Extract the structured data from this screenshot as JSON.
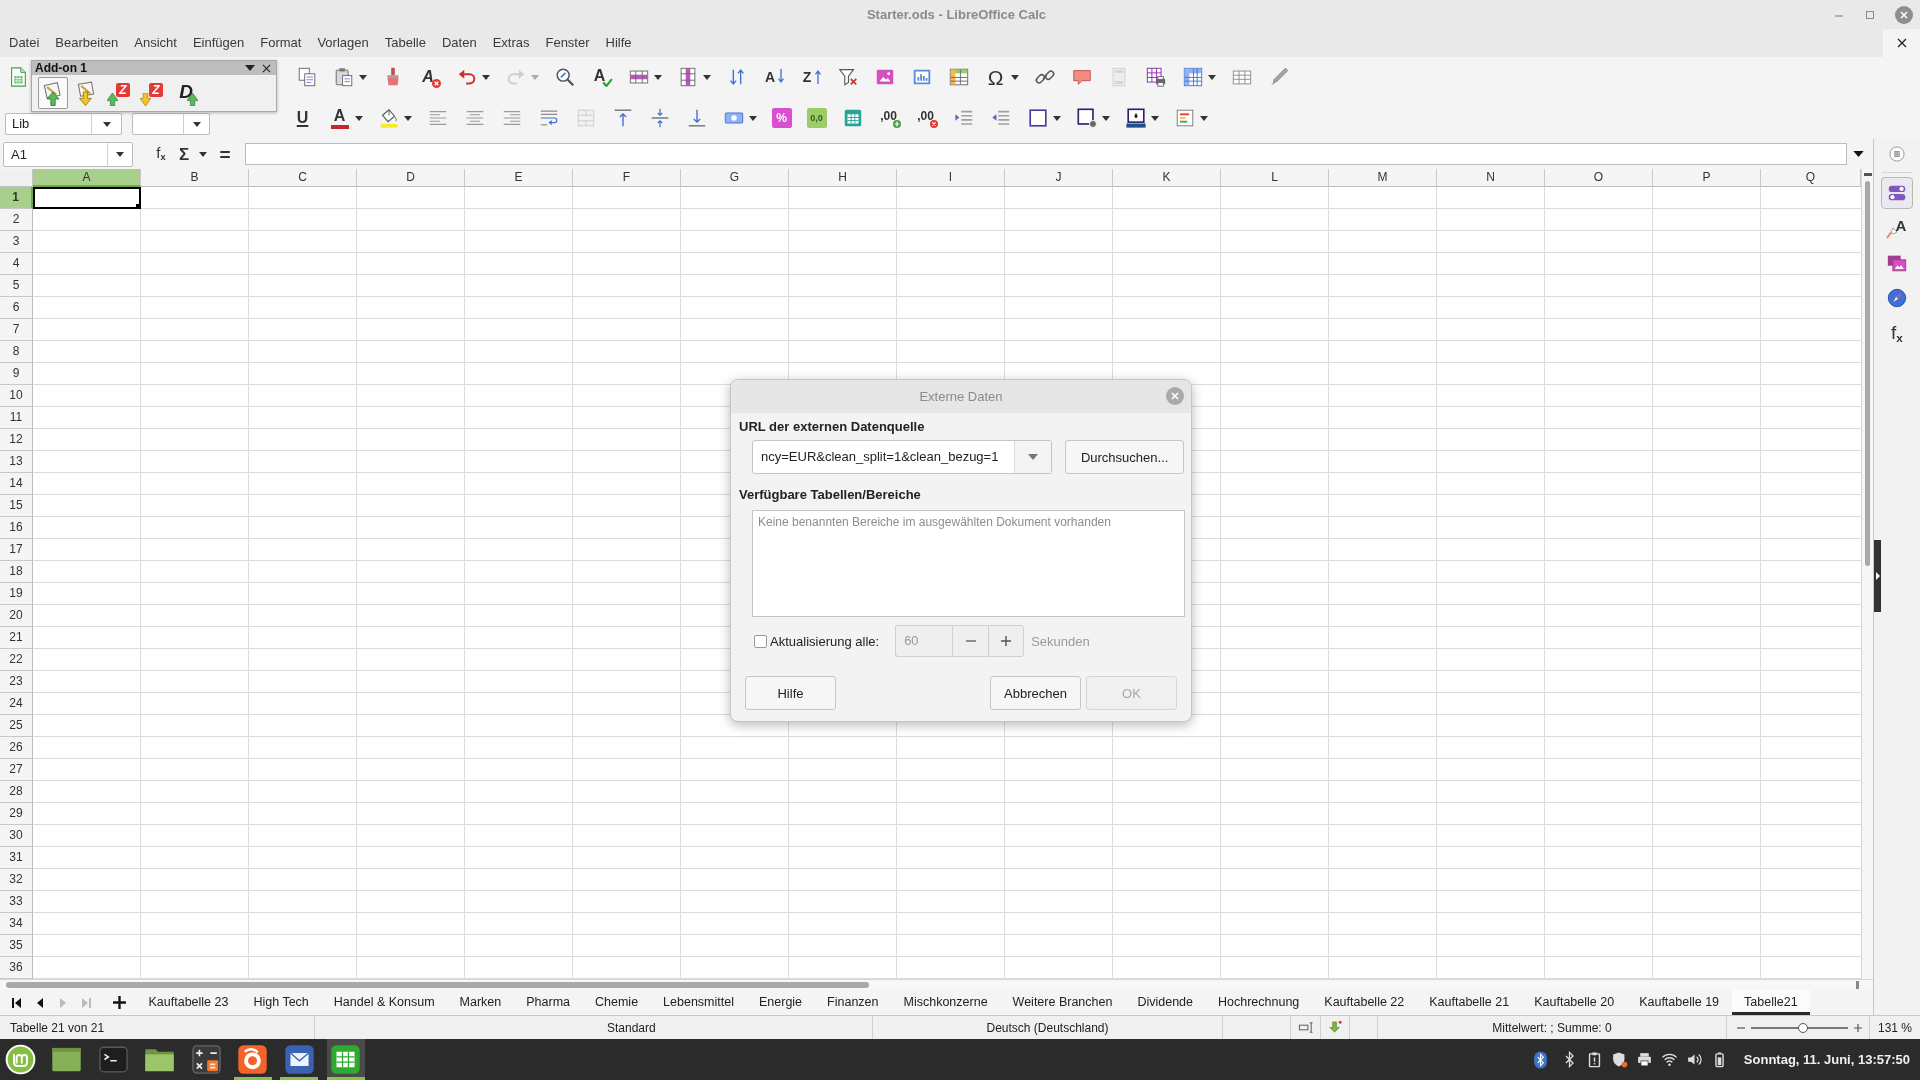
{
  "window": {
    "title": "Starter.ods - LibreOffice Calc"
  },
  "menu_bar": [
    "Datei",
    "Bearbeiten",
    "Ansicht",
    "Einfügen",
    "Format",
    "Vorlagen",
    "Tabelle",
    "Daten",
    "Extras",
    "Fenster",
    "Hilfe"
  ],
  "standard_toolbar": [
    {
      "kind": "newsheet",
      "disabled": false
    },
    {
      "kind": "copy",
      "disabled": false
    },
    {
      "kind": "paste",
      "disabled": false,
      "menu": true
    },
    {
      "kind": "clone",
      "disabled": false
    },
    {
      "kind": "clear",
      "glyph": "A",
      "disabled": false
    },
    {
      "kind": "undo",
      "disabled": false,
      "menu": true
    },
    {
      "kind": "redo",
      "disabled": true,
      "menu": true
    },
    {
      "kind": "find",
      "disabled": false
    },
    {
      "kind": "spelling",
      "glyph": "A",
      "disabled": false
    },
    {
      "kind": "rows",
      "disabled": false,
      "menu": true
    },
    {
      "kind": "columns",
      "disabled": false,
      "menu": true
    },
    {
      "kind": "sort",
      "disabled": false
    },
    {
      "kind": "sortasc",
      "glyph": "A",
      "disabled": false
    },
    {
      "kind": "sortdesc",
      "glyph": "Z",
      "disabled": false
    },
    {
      "kind": "autofilter",
      "disabled": false
    },
    {
      "kind": "image",
      "disabled": false
    },
    {
      "kind": "chart",
      "disabled": false
    },
    {
      "kind": "pivot",
      "disabled": false
    },
    {
      "kind": "special",
      "glyph": "Ω",
      "disabled": false,
      "menu": true
    },
    {
      "kind": "link",
      "disabled": false
    },
    {
      "kind": "comment",
      "disabled": false
    },
    {
      "kind": "headers",
      "disabled": true
    },
    {
      "kind": "printarea",
      "disabled": false
    },
    {
      "kind": "freeze",
      "disabled": false,
      "menu": true
    },
    {
      "kind": "split",
      "disabled": false
    },
    {
      "kind": "draw",
      "disabled": false
    }
  ],
  "addon_toolbar": {
    "title": "Add-on 1",
    "items": [
      {
        "kind": "sheetup",
        "selected": true
      },
      {
        "kind": "sheetdown",
        "selected": false
      },
      {
        "kind": "zup",
        "glyph": "Z",
        "selected": false
      },
      {
        "kind": "zdown",
        "glyph": "Z",
        "selected": false
      },
      {
        "kind": "dup",
        "glyph": "D",
        "selected": false
      }
    ]
  },
  "formatting_toolbar": {
    "font_name": {
      "value": "Lib"
    },
    "items": [
      {
        "kind": "underline",
        "glyph": "U",
        "disabled": false
      },
      {
        "kind": "fontcolor",
        "glyph": "A",
        "disabled": false,
        "menu": true
      },
      {
        "kind": "highlight",
        "disabled": false,
        "menu": true
      },
      {
        "kind": "alignleft",
        "disabled": false
      },
      {
        "kind": "aligncenter",
        "disabled": false
      },
      {
        "kind": "alignright",
        "disabled": false
      },
      {
        "kind": "wrap",
        "disabled": false
      },
      {
        "kind": "merge",
        "disabled": true
      },
      {
        "kind": "aligntop",
        "disabled": false
      },
      {
        "kind": "alignmiddle",
        "disabled": false
      },
      {
        "kind": "alignbottom",
        "disabled": false
      },
      {
        "kind": "currency",
        "disabled": false,
        "menu": true
      },
      {
        "kind": "percent",
        "glyph": "%",
        "disabled": false
      },
      {
        "kind": "number",
        "glyph": "0,0",
        "disabled": false
      },
      {
        "kind": "date",
        "disabled": false
      },
      {
        "kind": "adddecimal",
        "glyph": ",00",
        "disabled": false
      },
      {
        "kind": "deldecimal",
        "glyph": ",00",
        "disabled": false
      },
      {
        "kind": "indent",
        "disabled": false
      },
      {
        "kind": "outdent",
        "disabled": false
      },
      {
        "kind": "borders",
        "disabled": false,
        "menu": true
      },
      {
        "kind": "borderstyle",
        "disabled": false,
        "menu": true
      },
      {
        "kind": "bordercolor",
        "disabled": false,
        "menu": true
      },
      {
        "kind": "conditional",
        "disabled": false,
        "menu": true
      }
    ]
  },
  "formula_bar": {
    "name_box": "A1",
    "tools": [
      {
        "kind": "wizard",
        "glyph": "f$_{x}$"
      },
      {
        "kind": "sum",
        "glyph": "Σ",
        "menu": true
      },
      {
        "kind": "formula",
        "glyph": "="
      }
    ]
  },
  "sheet": {
    "columns": [
      {
        "label": "A",
        "selected": true
      },
      {
        "label": "B",
        "selected": false
      },
      {
        "label": "C",
        "selected": false
      },
      {
        "label": "D",
        "selected": false
      },
      {
        "label": "E",
        "selected": false
      },
      {
        "label": "F",
        "selected": false
      },
      {
        "label": "G",
        "selected": false
      },
      {
        "label": "H",
        "selected": false
      },
      {
        "label": "I",
        "selected": false
      },
      {
        "label": "J",
        "selected": false
      },
      {
        "label": "K",
        "selected": false
      },
      {
        "label": "L",
        "selected": false
      },
      {
        "label": "M",
        "selected": false
      },
      {
        "label": "N",
        "selected": false
      },
      {
        "label": "O",
        "selected": false
      },
      {
        "label": "P",
        "selected": false
      },
      {
        "label": "Q",
        "selected": false
      }
    ],
    "rows": [
      {
        "label": "1",
        "selected": true
      },
      {
        "label": "2",
        "selected": false
      },
      {
        "label": "3",
        "selected": false
      },
      {
        "label": "4",
        "selected": false
      },
      {
        "label": "5",
        "selected": false
      },
      {
        "label": "6",
        "selected": false
      },
      {
        "label": "7",
        "selected": false
      },
      {
        "label": "8",
        "selected": false
      },
      {
        "label": "9",
        "selected": false
      },
      {
        "label": "10",
        "selected": false
      },
      {
        "label": "11",
        "selected": false
      },
      {
        "label": "12",
        "selected": false
      },
      {
        "label": "13",
        "selected": false
      },
      {
        "label": "14",
        "selected": false
      },
      {
        "label": "15",
        "selected": false
      },
      {
        "label": "16",
        "selected": false
      },
      {
        "label": "17",
        "selected": false
      },
      {
        "label": "18",
        "selected": false
      },
      {
        "label": "19",
        "selected": false
      },
      {
        "label": "20",
        "selected": false
      },
      {
        "label": "21",
        "selected": false
      },
      {
        "label": "22",
        "selected": false
      },
      {
        "label": "23",
        "selected": false
      },
      {
        "label": "24",
        "selected": false
      },
      {
        "label": "25",
        "selected": false
      },
      {
        "label": "26",
        "selected": false
      },
      {
        "label": "27",
        "selected": false
      },
      {
        "label": "28",
        "selected": false
      },
      {
        "label": "29",
        "selected": false
      },
      {
        "label": "30",
        "selected": false
      },
      {
        "label": "31",
        "selected": false
      },
      {
        "label": "32",
        "selected": false
      },
      {
        "label": "33",
        "selected": false
      },
      {
        "label": "34",
        "selected": false
      },
      {
        "label": "35",
        "selected": false
      },
      {
        "label": "36",
        "selected": false
      }
    ]
  },
  "dialog": {
    "title": "Externe Daten",
    "url_label": "URL der externen Datenquelle",
    "url": {
      "value": "ncy=EUR&clean_split=1&clean_bezug=1"
    },
    "browse_button": "Durchsuchen...",
    "tables_label": "Verfügbare Tabellen/Bereiche",
    "tables_empty_message": "Keine benannten Bereiche im ausgewählten Dokument vorhanden",
    "refresh": {
      "label": "Aktualisierung alle:",
      "checked": false
    },
    "interval": {
      "value": "60",
      "disabled": true,
      "unit": "Sekunden"
    },
    "buttons": [
      {
        "label": "Hilfe",
        "disabled": false
      },
      {
        "label": "Abbrechen",
        "disabled": false
      },
      {
        "label": "OK",
        "disabled": true
      }
    ]
  },
  "sheet_tabs": {
    "navigation": [
      {
        "kind": "first",
        "disabled": false
      },
      {
        "kind": "previous",
        "disabled": false
      },
      {
        "kind": "next",
        "disabled": true
      },
      {
        "kind": "last",
        "disabled": true
      }
    ],
    "tabs": [
      {
        "label": "Kauftabelle 23",
        "selected": false
      },
      {
        "label": "High Tech",
        "selected": false
      },
      {
        "label": "Handel & Konsum",
        "selected": false
      },
      {
        "label": "Marken",
        "selected": false
      },
      {
        "label": "Pharma",
        "selected": false
      },
      {
        "label": "Chemie",
        "selected": false
      },
      {
        "label": "Lebensmittel",
        "selected": false
      },
      {
        "label": "Energie",
        "selected": false
      },
      {
        "label": "Finanzen",
        "selected": false
      },
      {
        "label": "Mischkonzerne",
        "selected": false
      },
      {
        "label": "Weitere Branchen",
        "selected": false
      },
      {
        "label": "Dividende",
        "selected": false
      },
      {
        "label": "Hochrechnung",
        "selected": false
      },
      {
        "label": "Kauftabelle 22",
        "selected": false
      },
      {
        "label": "Kauftabelle 21",
        "selected": false
      },
      {
        "label": "Kauftabelle 20",
        "selected": false
      },
      {
        "label": "Kauftabelle 19",
        "selected": false
      },
      {
        "label": "Tabelle21",
        "selected": true
      }
    ]
  },
  "status_bar": {
    "sheet_position": "Tabelle 21 von 21",
    "page_style": "Standard",
    "language": "Deutsch (Deutschland)",
    "selection_summary": "Mittelwert: ; Summe: 0",
    "zoom": {
      "level": 0.54,
      "reading": "131 %"
    }
  },
  "sidebar": {
    "items": [
      {
        "kind": "properties",
        "selected": true
      },
      {
        "kind": "styles",
        "glyph": "A",
        "selected": false
      },
      {
        "kind": "gallery",
        "selected": false
      },
      {
        "kind": "navigator",
        "selected": false
      },
      {
        "kind": "functions",
        "glyph": "f$_{x}$",
        "selected": false
      }
    ]
  },
  "taskbar": {
    "apps": [
      {
        "kind": "menu",
        "running": false,
        "selected": false
      },
      {
        "kind": "desktop",
        "running": false,
        "selected": false
      },
      {
        "kind": "terminal",
        "running": false,
        "selected": false
      },
      {
        "kind": "files",
        "running": false,
        "selected": false
      },
      {
        "kind": "calculator",
        "running": false,
        "selected": false
      },
      {
        "kind": "browser",
        "running": true,
        "selected": false
      },
      {
        "kind": "mail",
        "running": true,
        "selected": false
      },
      {
        "kind": "spreadsheet",
        "running": true,
        "selected": true
      }
    ],
    "clock": "Sonntag, 11. Juni, 13:57:50"
  }
}
